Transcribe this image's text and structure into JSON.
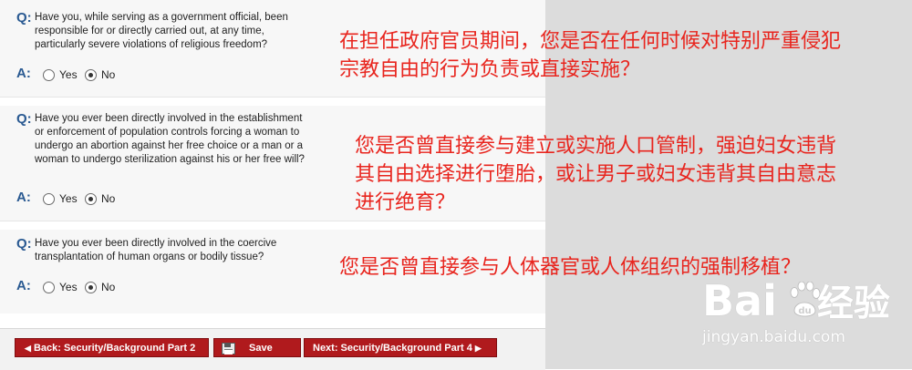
{
  "questions": [
    {
      "q_label": "Q:",
      "q_lines": [
        "Have you, while serving as a government official, been",
        "responsible for or directly carried out, at any time,",
        "particularly severe violations of religious freedom?"
      ],
      "a_label": "A:",
      "options": [
        {
          "label": "Yes",
          "checked": false
        },
        {
          "label": "No",
          "checked": true
        }
      ],
      "translation_lines": [
        "在担任政府官员期间，您是否在任何时候对特别严重侵犯",
        "宗教自由的行为负责或直接实施？"
      ]
    },
    {
      "q_label": "Q:",
      "q_lines": [
        "Have you ever been directly involved in the establishment",
        "or enforcement of population controls forcing a woman to",
        "undergo an abortion against her free choice or a man or a",
        "woman to undergo sterilization against his or her free will?"
      ],
      "a_label": "A:",
      "options": [
        {
          "label": "Yes",
          "checked": false
        },
        {
          "label": "No",
          "checked": true
        }
      ],
      "translation_lines": [
        "您是否曾直接参与建立或实施人口管制，强迫妇女违背",
        "其自由选择进行堕胎，或让男子或妇女违背其自由意志",
        "进行绝育？"
      ]
    },
    {
      "q_label": "Q:",
      "q_lines": [
        "Have you ever been directly involved in the coercive",
        "transplantation of human organs or bodily tissue?"
      ],
      "a_label": "A:",
      "options": [
        {
          "label": "Yes",
          "checked": false
        },
        {
          "label": "No",
          "checked": true
        }
      ],
      "translation_lines": [
        "您是否曾直接参与人体器官或人体组织的强制移植？"
      ]
    }
  ],
  "buttons": {
    "back_label": "Back: Security/Background Part 2",
    "save_label": "Save",
    "next_label": "Next: Security/Background Part 4",
    "back_arrow": "◀",
    "next_arrow": "▶"
  },
  "watermark": {
    "logo_text_left": "Bai",
    "logo_text_right": "经验",
    "sub_text": "jingyan.baidu.com"
  },
  "colors": {
    "accent_blue": "#2a5a92",
    "button_red": "#b01a1d",
    "annotation_red": "#e8251e"
  }
}
